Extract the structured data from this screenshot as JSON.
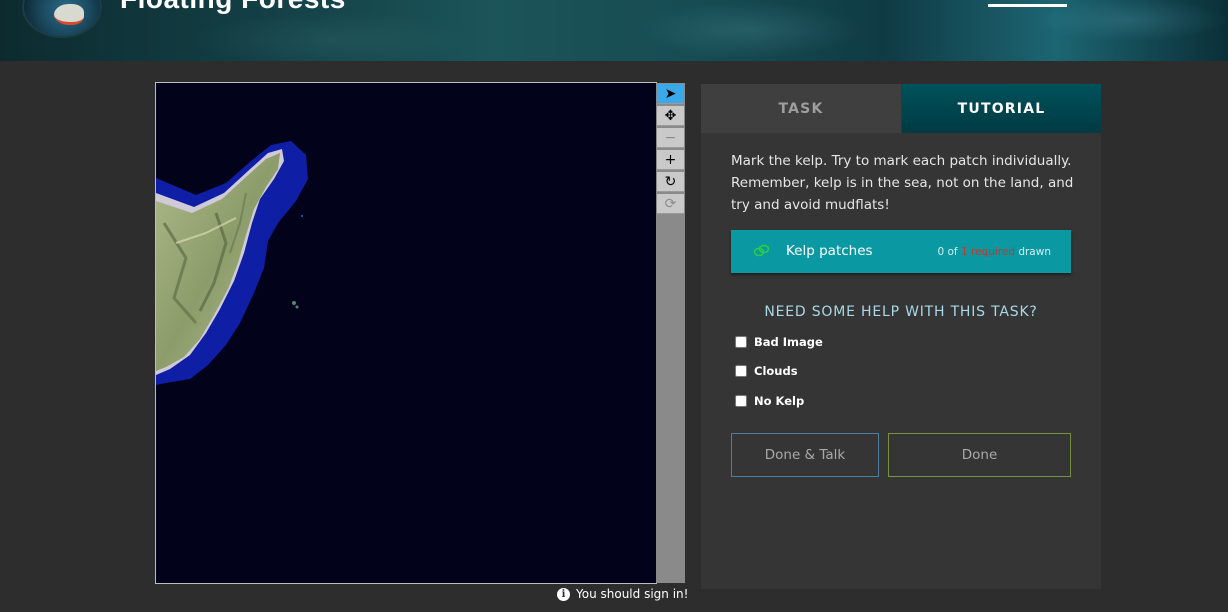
{
  "header": {
    "project_title": "Floating Forests"
  },
  "viewer": {
    "tools": [
      {
        "name": "select",
        "glyph": "➤"
      },
      {
        "name": "pan",
        "glyph": "✥"
      },
      {
        "name": "zoom-out",
        "glyph": "−"
      },
      {
        "name": "zoom-in",
        "glyph": "+"
      },
      {
        "name": "rotate",
        "glyph": "↻"
      },
      {
        "name": "reset",
        "glyph": "⟳"
      }
    ]
  },
  "signin": {
    "info_glyph": "i",
    "text": "You should sign in!"
  },
  "tabs": {
    "task": "TASK",
    "tutorial": "TUTORIAL"
  },
  "task": {
    "instructions": "Mark the kelp. Try to mark each patch individually. Remember, kelp is in the sea, not on the land, and try and avoid mudflats!",
    "tool": {
      "label": "Kelp patches",
      "count_prefix": "0 of",
      "count_required": "1 required",
      "count_suffix": "drawn"
    },
    "help_title": "NEED SOME HELP WITH THIS TASK?",
    "options": [
      "Bad Image",
      "Clouds",
      "No Kelp"
    ],
    "done_talk_label": "Done & Talk",
    "done_label": "Done"
  },
  "colors": {
    "active_tool": "#3aa9ea",
    "tutorial_tab": "#003a42",
    "kelp_tool": "#0a98a3",
    "required_text": "#c0392b",
    "help_title": "#a8d8e8"
  }
}
